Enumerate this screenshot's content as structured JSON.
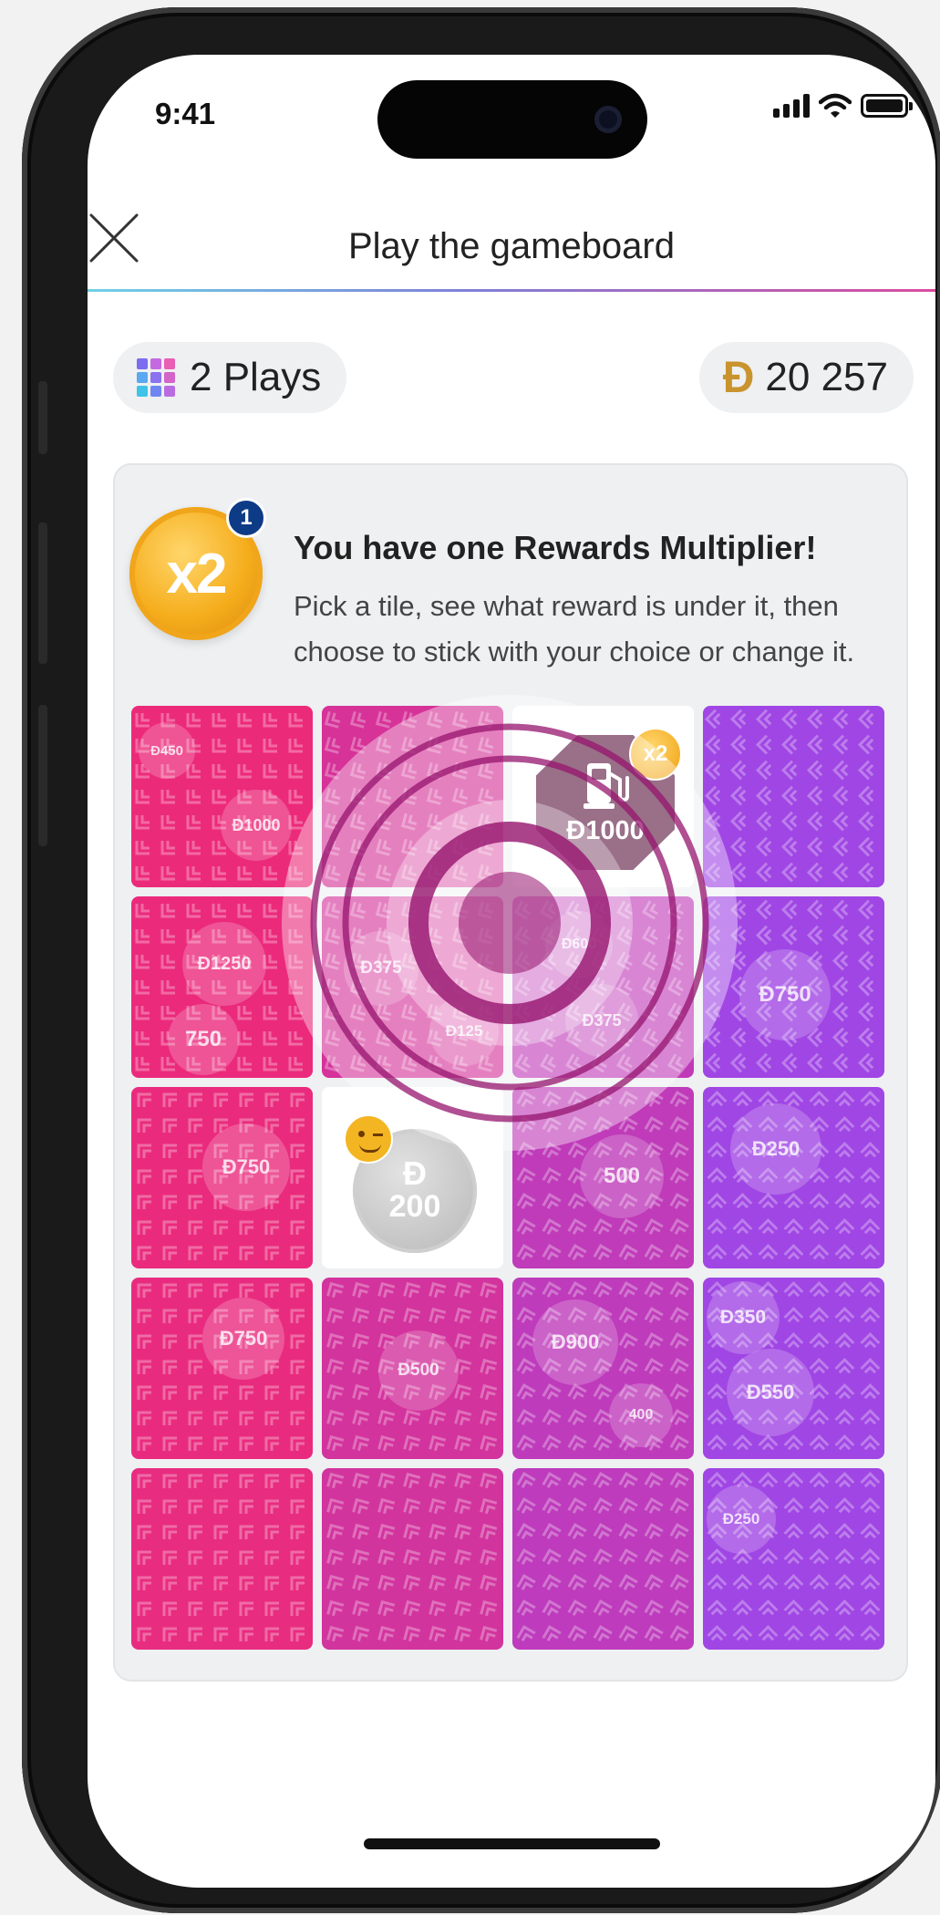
{
  "status_bar": {
    "time": "9:41"
  },
  "header": {
    "title": "Play the gameboard",
    "close_icon": "close-icon"
  },
  "plays": {
    "count_label": "2 Plays",
    "icon": "grid-icon",
    "icon_colors": [
      "#7b6cf0",
      "#c46ae0",
      "#e85fb3",
      "#5aa8f0",
      "#8b72ee",
      "#d364c9",
      "#3fc3e8",
      "#6f86f2",
      "#b96ce0"
    ]
  },
  "points": {
    "symbol": "Ð",
    "balance": "20 257",
    "coin_color": "#c9932e"
  },
  "multiplier": {
    "badge_label": "x2",
    "count": "1",
    "title": "You have one Rewards Multiplier!",
    "description": "Pick a tile, see what reward is under it, then choose to stick with your choice or change it."
  },
  "gameboard": {
    "rows": 5,
    "cols": 4,
    "colors": {
      "pink": "#ec2a7a",
      "purple": "#a046e4",
      "revealed_prize": "#5c1840"
    },
    "revealed": [
      {
        "row": 0,
        "col": 2,
        "label": "Ð1000",
        "icon": "fuel-pump-icon",
        "multiplier": "x2"
      },
      {
        "row": 2,
        "col": 1,
        "symbol": "Ð",
        "label": "200",
        "icon": "wink-emoji-icon"
      }
    ],
    "ghost_rewards": [
      {
        "row": 0,
        "col": 0,
        "label": "Ð450"
      },
      {
        "row": 0,
        "col": 0,
        "label": "Ð1000"
      },
      {
        "row": 1,
        "col": 0,
        "label": "Ð1250"
      },
      {
        "row": 1,
        "col": 0,
        "label": "750"
      },
      {
        "row": 1,
        "col": 1,
        "label": "Ð375"
      },
      {
        "row": 1,
        "col": 1,
        "label": "Ð125"
      },
      {
        "row": 1,
        "col": 2,
        "label": "Ð600"
      },
      {
        "row": 1,
        "col": 2,
        "label": "Ð375"
      },
      {
        "row": 1,
        "col": 3,
        "label": "Ð750"
      },
      {
        "row": 2,
        "col": 0,
        "label": "Ð750"
      },
      {
        "row": 2,
        "col": 2,
        "label": "500"
      },
      {
        "row": 2,
        "col": 3,
        "label": "Ð250"
      },
      {
        "row": 3,
        "col": 0,
        "label": "Ð750"
      },
      {
        "row": 3,
        "col": 1,
        "label": "Ð500"
      },
      {
        "row": 3,
        "col": 2,
        "label": "Ð900"
      },
      {
        "row": 3,
        "col": 2,
        "label": "400"
      },
      {
        "row": 3,
        "col": 3,
        "label": "Ð350"
      },
      {
        "row": 3,
        "col": 3,
        "label": "Ð550"
      },
      {
        "row": 4,
        "col": 3,
        "label": "Ð250"
      }
    ]
  }
}
